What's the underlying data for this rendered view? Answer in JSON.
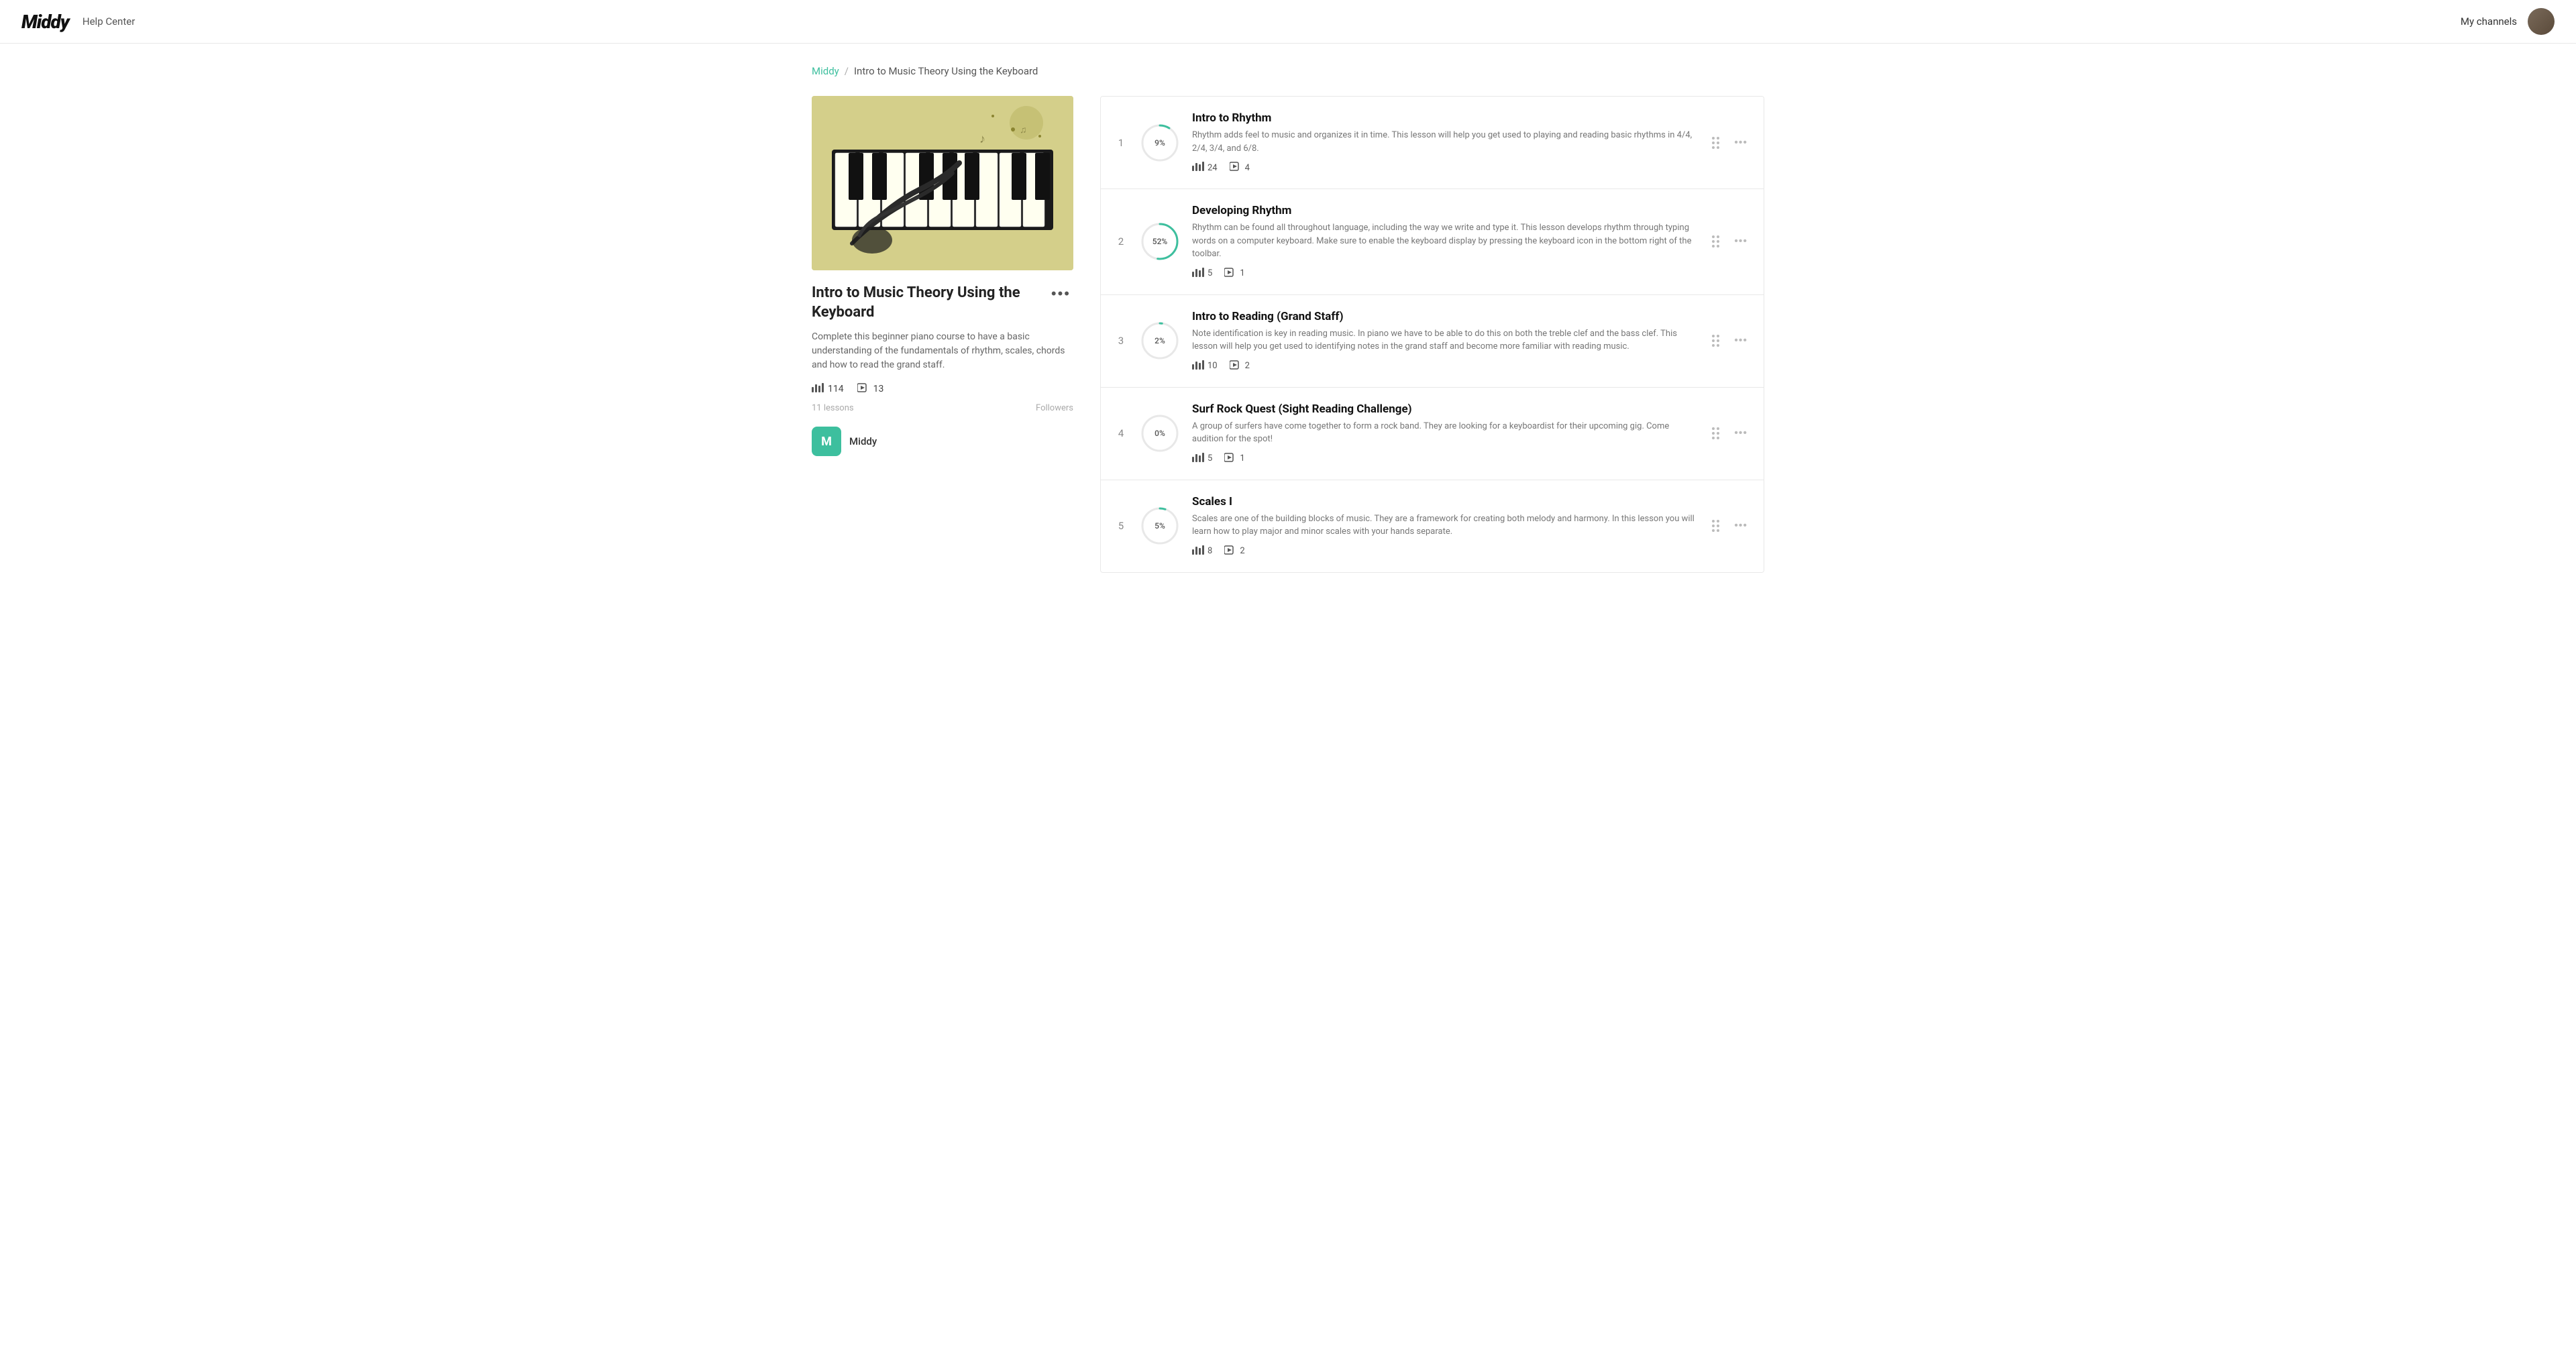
{
  "header": {
    "logo": "Middy",
    "help_center": "Help Center",
    "my_channels": "My channels"
  },
  "breadcrumb": {
    "home": "Middy",
    "separator": "/",
    "current": "Intro to Music Theory Using the Keyboard"
  },
  "course": {
    "title": "Intro to Music Theory Using the Keyboard",
    "description": "Complete this beginner piano course to have a basic understanding of the fundamentals of rhythm, scales, chords and how to read the grand staff.",
    "stats_exercises": "114",
    "stats_videos": "13",
    "lessons_count": "11 lessons",
    "followers_label": "Followers",
    "author_initial": "M",
    "author_name": "Middy",
    "more_dots": "•••"
  },
  "lessons": [
    {
      "number": "1",
      "progress_pct": 9,
      "progress_label": "9%",
      "title": "Intro to Rhythm",
      "description": "Rhythm adds feel to music and organizes it in time. This lesson will help you get used to playing and reading basic rhythms in 4/4, 2/4, 3/4, and 6/8.",
      "exercises": "24",
      "videos": "4",
      "stroke_color": "#3dbf9e"
    },
    {
      "number": "2",
      "progress_pct": 52,
      "progress_label": "52%",
      "title": "Developing Rhythm",
      "description": "Rhythm can be found all throughout language, including the way we write and type it. This lesson develops rhythm through typing words on a computer keyboard. Make sure to enable the keyboard display by pressing the keyboard icon in the bottom right of the toolbar.",
      "exercises": "5",
      "videos": "1",
      "stroke_color": "#3dbf9e"
    },
    {
      "number": "3",
      "progress_pct": 2,
      "progress_label": "2%",
      "title": "Intro to Reading (Grand Staff)",
      "description": "Note identification is key in reading music. In piano we have to be able to do this on both the treble clef and the bass clef. This lesson will help you get used to identifying notes in the grand staff and become more familiar with reading music.",
      "exercises": "10",
      "videos": "2",
      "stroke_color": "#3dbf9e"
    },
    {
      "number": "4",
      "progress_pct": 0,
      "progress_label": "0%",
      "title": "Surf Rock Quest (Sight Reading Challenge)",
      "description": "A group of surfers have come together to form a rock band. They are looking for a keyboardist for their upcoming gig. Come audition for the spot!",
      "exercises": "5",
      "videos": "1",
      "stroke_color": "#3dbf9e"
    },
    {
      "number": "5",
      "progress_pct": 5,
      "progress_label": "5%",
      "title": "Scales I",
      "description": "Scales are one of the building blocks of music. They are a framework for creating both melody and harmony. In this lesson you will learn how to play major and minor scales with your hands separate.",
      "exercises": "8",
      "videos": "2",
      "stroke_color": "#3dbf9e"
    }
  ],
  "icons": {
    "grid_drag": "⋮⋮",
    "more_options": "•••"
  }
}
